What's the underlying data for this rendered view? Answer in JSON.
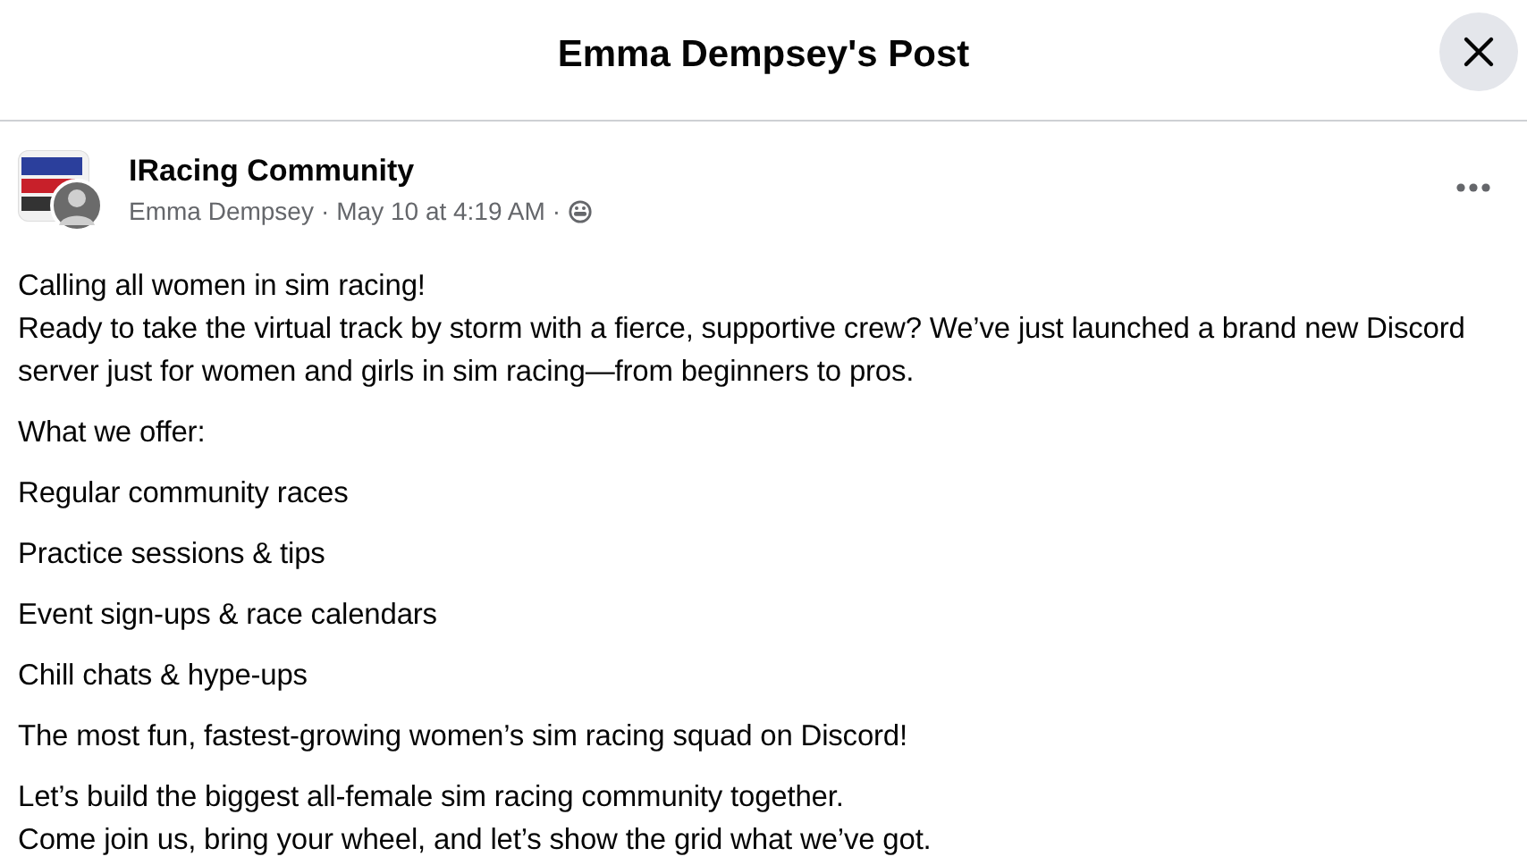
{
  "dialog": {
    "title": "Emma Dempsey's Post"
  },
  "post": {
    "group": "IRacing Community",
    "author": "Emma Dempsey",
    "separator_1": "·",
    "time": "May 10 at 4:19 AM",
    "separator_2": "·",
    "paragraphs": [
      "Calling all women in sim racing!\nReady to take the virtual track by storm with a fierce, supportive crew? We’ve just launched a brand new Discord server just for women and girls in sim racing—from beginners to pros.",
      "What we offer:",
      "Regular community races",
      "Practice sessions & tips",
      "Event sign-ups & race calendars",
      "Chill chats & hype-ups",
      "The most fun, fastest-growing women’s sim racing squad on Discord!",
      "Let’s build the biggest all-female sim racing community together.\nCome join us, bring your wheel, and let’s show the grid what we’ve got."
    ]
  }
}
